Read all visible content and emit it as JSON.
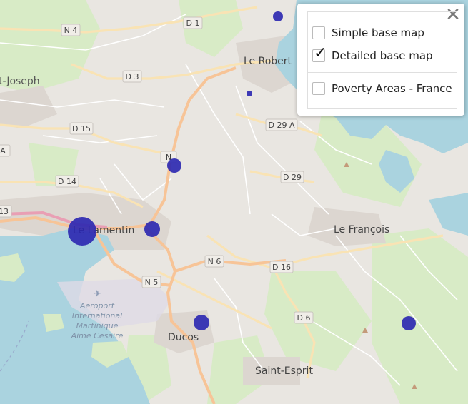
{
  "map": {
    "colors": {
      "land": "#e9e6e1",
      "water": "#aad3df",
      "green": "#d8ebc6",
      "urban": "#dcd6d0",
      "major_road": "#f7c497",
      "primary_road": "#f9e3b4",
      "marker": "#2a26b0"
    },
    "place_labels": [
      {
        "key": "saint_joseph",
        "text": "t-Joseph"
      },
      {
        "key": "le_robert",
        "text": "Le Robert"
      },
      {
        "key": "le_lamentin",
        "text": "Le Lamentin"
      },
      {
        "key": "le_francois",
        "text": "Le François"
      },
      {
        "key": "ducos",
        "text": "Ducos"
      },
      {
        "key": "saint_esprit",
        "text": "Saint-Esprit"
      }
    ],
    "road_shields": [
      "N 4",
      "D 1",
      "D 3",
      "D 15",
      "D 14",
      "N 6",
      "N 5",
      "D 16",
      "D 6",
      "D 29 A",
      "D 29",
      "N",
      "13",
      "A"
    ],
    "airport_label": [
      "Aeroport",
      "International",
      "Martinique",
      "Aime Cesaire"
    ],
    "markers": [
      {
        "name": "le-robert-north",
        "size": "small"
      },
      {
        "name": "le-robert-south",
        "size": "tiny"
      },
      {
        "name": "n1-point",
        "size": "small"
      },
      {
        "name": "le-lamentin-center",
        "size": "large"
      },
      {
        "name": "le-lamentin-east",
        "size": "small"
      },
      {
        "name": "ducos",
        "size": "small"
      },
      {
        "name": "le-francois-south",
        "size": "small"
      }
    ]
  },
  "layer_control": {
    "close_symbol": "✕",
    "checkmark": "✓",
    "base_layers": [
      {
        "label": "Simple base map",
        "checked": false
      },
      {
        "label": "Detailed base map",
        "checked": true
      }
    ],
    "overlays": [
      {
        "label": "Poverty Areas - France",
        "checked": false
      }
    ]
  }
}
